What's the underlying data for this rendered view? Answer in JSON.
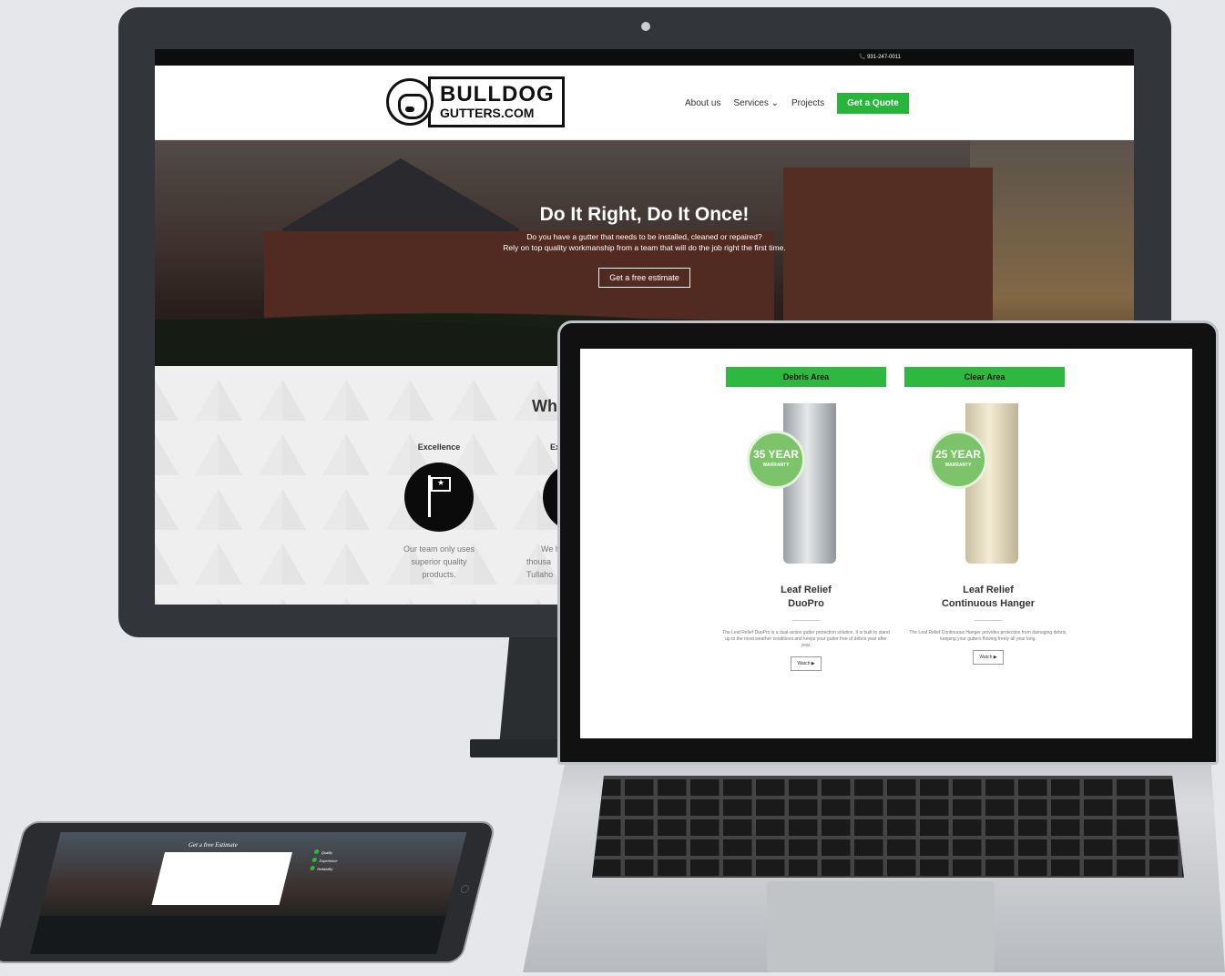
{
  "desktop": {
    "topbar_phone": "📞 931-247-0011",
    "logo_main": "BULLDOG",
    "logo_sub": "GUTTERS.COM",
    "nav": [
      "About us",
      "Services ⌄",
      "Projects"
    ],
    "cta": "Get a Quote",
    "hero_title": "Do It Right, Do It Once!",
    "hero_line1": "Do you have a gutter that needs to be installed, cleaned or repaired?",
    "hero_line2": "Rely on top quality workmanship from a team that will do the job right the first time.",
    "hero_button": "Get a free estimate",
    "why_title": "Wh",
    "features": [
      {
        "title": "Excellence",
        "text_lines": [
          "Our team only uses",
          "superior quality",
          "products."
        ]
      },
      {
        "title": "Ex",
        "text_lines": [
          "We h",
          "thousa",
          "Tullaho"
        ]
      }
    ]
  },
  "laptop": {
    "tabs": [
      "Debris Area",
      "Clear Area"
    ],
    "products": [
      {
        "badge_top": "35 YEAR",
        "badge_bottom": "WARRANTY",
        "name1": "Leaf Relief",
        "name2": "DuoPro",
        "desc": "The Leaf Relief DuoPro is a dual-action gutter protection solution. It is built to stand up to the most weather conditions and keeps your gutter free of debris year after year.",
        "button": "Watch ▶"
      },
      {
        "badge_top": "25 YEAR",
        "badge_bottom": "WARRANTY",
        "name1": "Leaf Relief",
        "name2": "Continuous Hanger",
        "desc": "The Leaf Relief Continuous Hanger provides protection from damaging debris, keeping your gutters flowing freely all year long.",
        "button": "Watch ▶"
      }
    ]
  },
  "tablet": {
    "form_title": "Get a free Estimate",
    "list": [
      "Quality",
      "Experience",
      "Reliability"
    ]
  },
  "colors": {
    "accent": "#2eb83f",
    "dark": "#32363a"
  }
}
